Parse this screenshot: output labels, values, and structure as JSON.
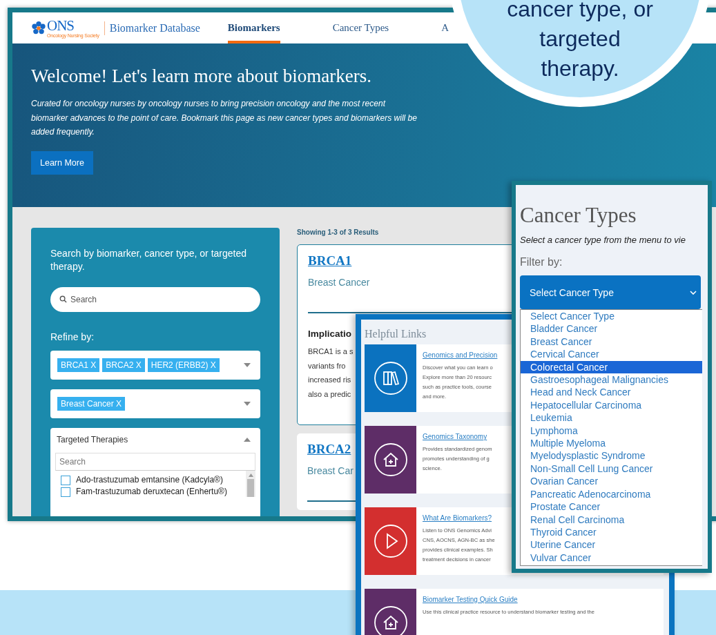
{
  "main_window": {
    "header": {
      "logo": {
        "wordmark": "ONS",
        "tagline": "Oncology Nursing Society"
      },
      "site_title": "Biomarker Database",
      "nav": [
        {
          "label": "Biomarkers",
          "selected": true
        },
        {
          "label": "Cancer Types",
          "selected": false
        },
        {
          "label": "A",
          "selected": false
        }
      ]
    },
    "hero": {
      "title": "Welcome! Let's learn more about biomarkers.",
      "description": "Curated for oncology nurses by oncology nurses to bring precision oncology and the most recent biomarker advances to the point of care. Bookmark this page as new cancer types and biomarkers will be added frequently.",
      "button": "Learn More"
    },
    "search_panel": {
      "prompt": "Search by biomarker, cancer type, or targeted therapy.",
      "search": {
        "placeholder": "Search"
      },
      "refine_label": "Refine by:",
      "filters": [
        {
          "kind": "tags",
          "tags": [
            {
              "label": "BRCA1",
              "remove": "X"
            },
            {
              "label": "BRCA2",
              "remove": "X"
            },
            {
              "label": "HER2 (ERBB2)",
              "remove": "X"
            }
          ]
        },
        {
          "kind": "tags",
          "tags": [
            {
              "label": "Breast Cancer",
              "remove": "X"
            }
          ]
        },
        {
          "kind": "list",
          "title": "Targeted Therapies",
          "expanded": true,
          "search": {
            "placeholder": "Search"
          },
          "options": [
            {
              "label": "Ado-trastuzumab emtansine (Kadcyla®)",
              "checked": false
            },
            {
              "label": "Fam-trastuzumab deruxtecan (Enhertu®)",
              "checked": false
            }
          ]
        }
      ]
    },
    "results": {
      "summary": "Showing 1-3 of 3 Results",
      "cards": [
        {
          "title": "BRCA1",
          "subtitle": "Breast Cancer",
          "section_title": "Implicatio",
          "body_lines": [
            "BRCA1 is a s",
            "variants fro",
            "increased ris",
            "also a predic"
          ]
        },
        {
          "title": "BRCA2",
          "subtitle": "Breast Car"
        }
      ]
    }
  },
  "helpful_links": {
    "title": "Helpful Links",
    "items": [
      {
        "kind": "books",
        "color": "#0b72bf",
        "title": "Genomics and Precision",
        "desc_lines": [
          "Discover what you can learn o",
          "Explore more than 20 resourc",
          "such as practice tools, course",
          "and more."
        ]
      },
      {
        "kind": "house",
        "color": "#5e2d67",
        "title": "Genomics Taxonomy",
        "desc_lines": [
          "Provides standardized genom",
          "promotes understanding of g",
          "science."
        ]
      },
      {
        "kind": "play",
        "color": "#d32f2f",
        "title": "What Are Biomarkers?",
        "desc_lines": [
          "Listen to ONS Genomics Advi",
          "CNS, AOCNS, AGN-BC as she",
          "provides clinical examples. Sh",
          "treatment decisions in cancer"
        ]
      },
      {
        "kind": "house",
        "color": "#5e2d67",
        "title": "Biomarker Testing Quick Guide",
        "desc_lines": [
          "Use this clinical practice resource to understand biomarker testing and the"
        ]
      }
    ]
  },
  "cancer_types": {
    "title": "Cancer Types",
    "subtitle": "Select a cancer type from the menu to vie",
    "filter_label": "Filter by:",
    "select": {
      "value": "Select Cancer Type",
      "expanded": true
    },
    "options": [
      {
        "label": "Select Cancer Type",
        "selected": false
      },
      {
        "label": "Bladder Cancer",
        "selected": false
      },
      {
        "label": "Breast Cancer",
        "selected": false
      },
      {
        "label": "Cervical Cancer",
        "selected": false
      },
      {
        "label": "Colorectal Cancer",
        "selected": true
      },
      {
        "label": "Gastroesophageal Malignancies",
        "selected": false
      },
      {
        "label": "Head and Neck Cancer",
        "selected": false
      },
      {
        "label": "Hepatocellular Carcinoma",
        "selected": false
      },
      {
        "label": "Leukemia",
        "selected": false
      },
      {
        "label": "Lymphoma",
        "selected": false
      },
      {
        "label": "Multiple Myeloma",
        "selected": false
      },
      {
        "label": "Myelodysplastic Syndrome",
        "selected": false
      },
      {
        "label": "Non-Small Cell Lung Cancer",
        "selected": false
      },
      {
        "label": "Ovarian Cancer",
        "selected": false
      },
      {
        "label": "Pancreatic Adenocarcinoma",
        "selected": false
      },
      {
        "label": "Prostate Cancer",
        "selected": false
      },
      {
        "label": "Renal Cell Carcinoma",
        "selected": false
      },
      {
        "label": "Thyroid Cancer",
        "selected": false
      },
      {
        "label": "Uterine Cancer",
        "selected": false
      },
      {
        "label": "Vulvar Cancer",
        "selected": false
      }
    ]
  },
  "callout": {
    "lines": [
      "cancer type, or",
      "targeted",
      "therapy."
    ]
  }
}
